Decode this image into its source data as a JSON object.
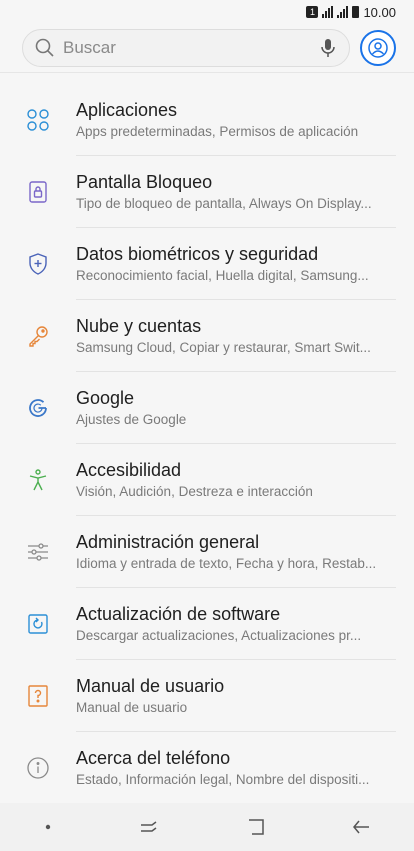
{
  "status_bar": {
    "sim": "1",
    "time": "10.00"
  },
  "search": {
    "placeholder": "Buscar"
  },
  "items": [
    {
      "title": "Aplicaciones",
      "subtitle": "Apps predeterminadas, Permisos de aplicación",
      "icon": "apps-icon",
      "color": "#2b8fd6"
    },
    {
      "title": "Pantalla Bloqueo",
      "subtitle": "Tipo de bloqueo de pantalla, Always On Display...",
      "icon": "lock-icon",
      "color": "#7a67c9"
    },
    {
      "title": "Datos biométricos y seguridad",
      "subtitle": "Reconocimiento facial, Huella digital, Samsung...",
      "icon": "shield-icon",
      "color": "#4a63b8"
    },
    {
      "title": "Nube y cuentas",
      "subtitle": "Samsung Cloud, Copiar y restaurar, Smart Swit...",
      "icon": "key-icon",
      "color": "#e6863a"
    },
    {
      "title": "Google",
      "subtitle": "Ajustes de Google",
      "icon": "google-icon",
      "color": "#3b78c9"
    },
    {
      "title": "Accesibilidad",
      "subtitle": "Visión, Audición, Destreza e interacción",
      "icon": "accessibility-icon",
      "color": "#4caf50"
    },
    {
      "title": "Administración general",
      "subtitle": "Idioma y entrada de texto, Fecha y hora, Restab...",
      "icon": "sliders-icon",
      "color": "#8a8a8a"
    },
    {
      "title": "Actualización de software",
      "subtitle": "Descargar actualizaciones, Actualizaciones pr...",
      "icon": "update-icon",
      "color": "#2b8fd6"
    },
    {
      "title": "Manual de usuario",
      "subtitle": "Manual de usuario",
      "icon": "manual-icon",
      "color": "#e6863a"
    },
    {
      "title": "Acerca del teléfono",
      "subtitle": "Estado, Información legal, Nombre del dispositi...",
      "icon": "info-icon",
      "color": "#8a8a8a"
    }
  ]
}
